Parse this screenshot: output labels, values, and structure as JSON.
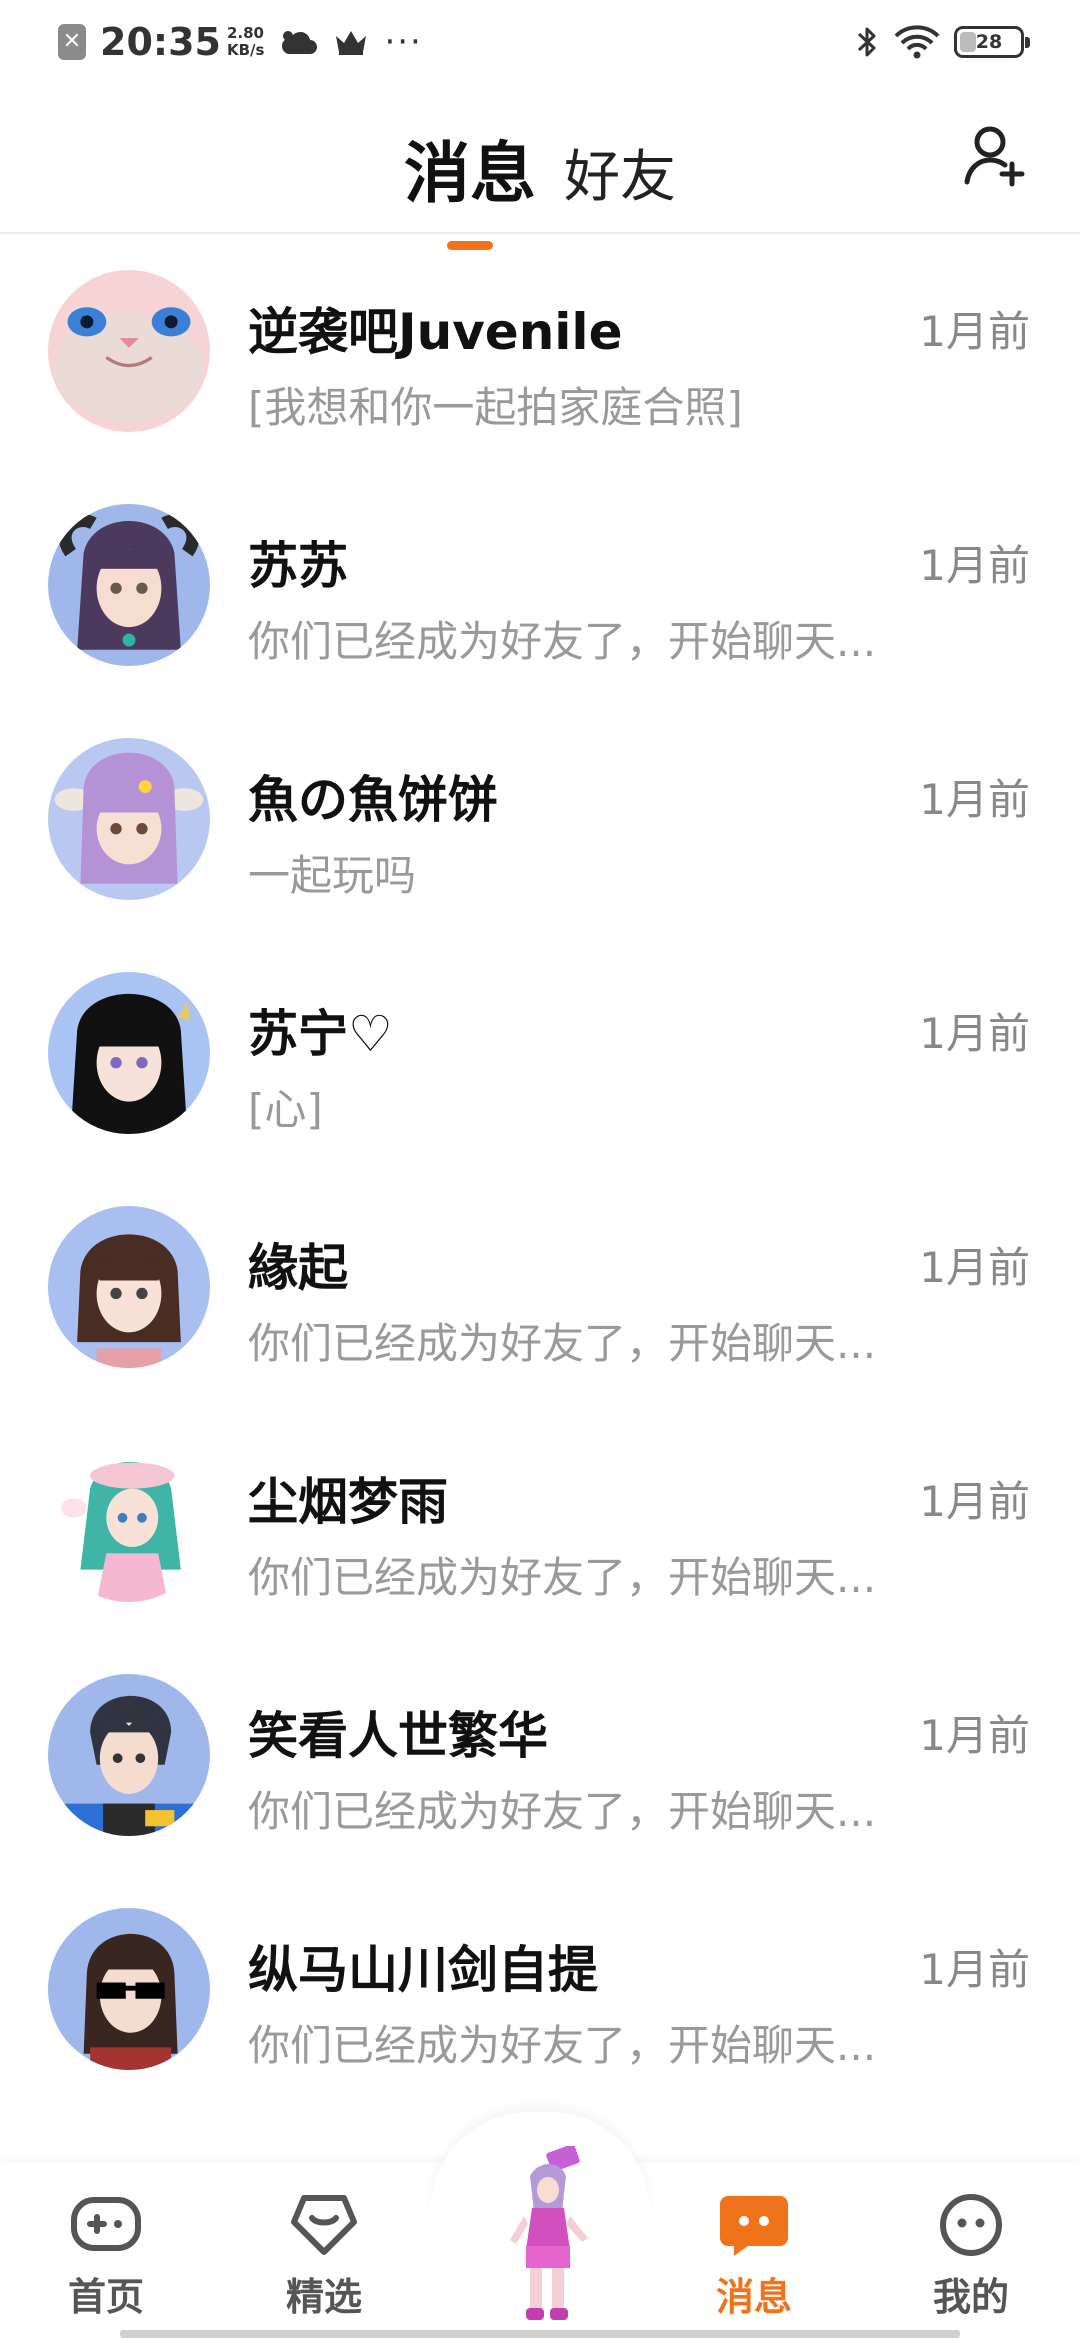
{
  "status_bar": {
    "time": "20:35",
    "speed_value": "2.80",
    "speed_unit": "KB/s",
    "battery": "28",
    "battery_level": 0.28,
    "dots": "···"
  },
  "header": {
    "tabs": [
      {
        "label": "消息",
        "active": true
      },
      {
        "label": "好友",
        "active": false
      }
    ],
    "accent_color": "#f0731c"
  },
  "conversations": [
    {
      "name": "逆袭吧Juvenile",
      "preview": "[我想和你一起拍家庭合照]",
      "time": "1月前",
      "avatar": "avatar-cat-mask",
      "bg": "#f3c5c6"
    },
    {
      "name": "苏苏",
      "preview": "你们已经成为好友了，开始聊天...",
      "time": "1月前",
      "avatar": "avatar-horned-girl",
      "bg": "#9fb7ea"
    },
    {
      "name": "魚の魚饼饼",
      "preview": "一起玩吗",
      "time": "1月前",
      "avatar": "avatar-purple-hair-girl",
      "bg": "#b9c8f0"
    },
    {
      "name": "苏宁♡",
      "preview": "[心]",
      "time": "1月前",
      "avatar": "avatar-black-hair-girl",
      "bg": "#a9c3f2"
    },
    {
      "name": "緣起",
      "preview": "你们已经成为好友了，开始聊天...",
      "time": "1月前",
      "avatar": "avatar-brown-hair-girl",
      "bg": "#a8bff0"
    },
    {
      "name": "尘烟梦雨",
      "preview": "你们已经成为好友了，开始聊天...",
      "time": "1月前",
      "avatar": "avatar-teal-hair-girl",
      "bg": "#ffffff"
    },
    {
      "name": "笑看人世繁华",
      "preview": "你们已经成为好友了，开始聊天...",
      "time": "1月前",
      "avatar": "avatar-dark-hair-boy",
      "bg": "#9fb7ea"
    },
    {
      "name": "纵马山川剑自提",
      "preview": "你们已经成为好友了，开始聊天...",
      "time": "1月前",
      "avatar": "avatar-sunglasses-boy",
      "bg": "#9fb7ea"
    }
  ],
  "bottom_nav": [
    {
      "label": "首页",
      "icon": "gamepad-icon",
      "active": false
    },
    {
      "label": "精选",
      "icon": "heart-badge-icon",
      "active": false
    },
    {
      "label": "",
      "icon": "avatar-character",
      "active": false
    },
    {
      "label": "消息",
      "icon": "chat-bubble-icon",
      "active": true
    },
    {
      "label": "我的",
      "icon": "smiley-face-icon",
      "active": false
    }
  ]
}
